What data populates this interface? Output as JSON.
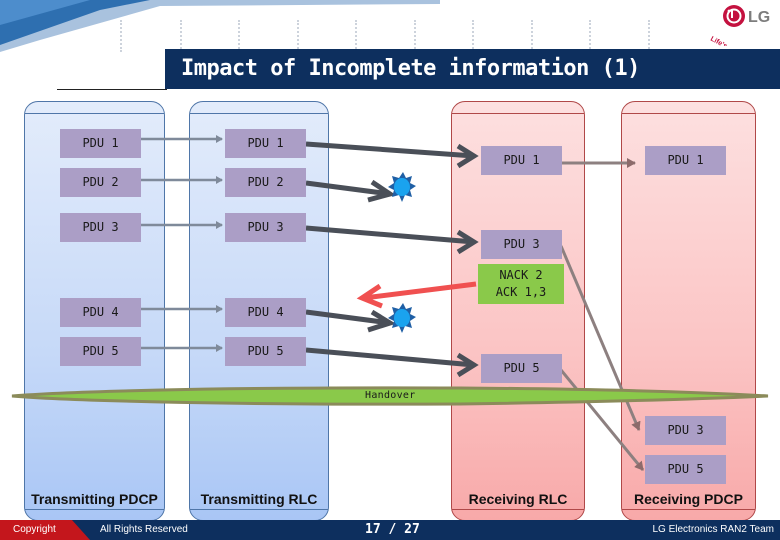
{
  "slide": {
    "title": "Impact of Incomplete information (1)",
    "brand": {
      "name": "LG",
      "tagline": "Life's Good"
    }
  },
  "columns": [
    {
      "id": "tx-pdcp",
      "label": "Transmitting PDCP",
      "side": "transmitting",
      "color": "#c6d9f8"
    },
    {
      "id": "tx-rlc",
      "label": "Transmitting RLC",
      "side": "transmitting",
      "color": "#c6d9f8"
    },
    {
      "id": "rx-rlc",
      "label": "Receiving RLC",
      "side": "receiving",
      "color": "#fbc4c4"
    },
    {
      "id": "rx-pdcp",
      "label": "Receiving PDCP",
      "side": "receiving",
      "color": "#fbc4c4"
    }
  ],
  "pdus": {
    "tx_pdcp": [
      "PDU 1",
      "PDU 2",
      "PDU 3",
      "PDU 4",
      "PDU 5"
    ],
    "tx_rlc": [
      "PDU 1",
      "PDU 2",
      "PDU 3",
      "PDU 4",
      "PDU 5"
    ],
    "rx_rlc": [
      "PDU 1",
      "PDU 3",
      "PDU 5"
    ],
    "rx_pdcp_before": [
      "PDU 1"
    ],
    "rx_pdcp_after": [
      "PDU 3",
      "PDU 5"
    ]
  },
  "status_report": {
    "line1": "NACK 2",
    "line2": "ACK 1,3"
  },
  "lost_pdus": [
    "PDU 2",
    "PDU 4"
  ],
  "handover_label": "Handover",
  "colors": {
    "pdu": "#ab9ec6",
    "ack": "#8ac94a",
    "nack_arrow": "#f05050",
    "handover": "#8ac94a",
    "lost_burst": "#1aa3ef",
    "title_bar": "#0d2f5e",
    "footer_red": "#c4161c"
  },
  "footer": {
    "copyright": "Copyright",
    "rights": "All Rights Reserved",
    "page": "17 / 27",
    "team": "LG Electronics RAN2 Team"
  }
}
